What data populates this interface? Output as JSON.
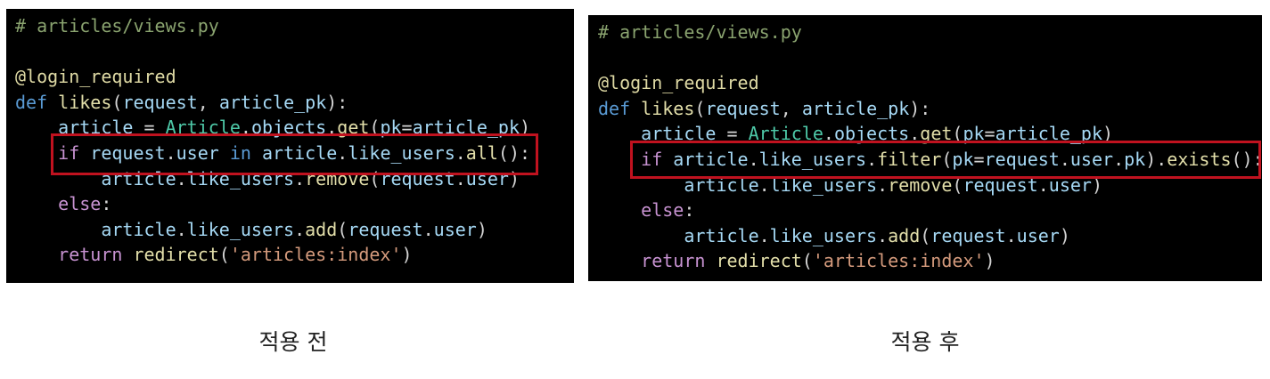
{
  "panels": [
    {
      "caption": "적용 전",
      "lines": [
        [
          {
            "t": "# articles/views.py",
            "c": "comment"
          }
        ],
        [],
        [
          {
            "t": "@login_required",
            "c": "decorator"
          }
        ],
        [
          {
            "t": "def ",
            "c": "keyword"
          },
          {
            "t": "likes",
            "c": "func"
          },
          {
            "t": "(",
            "c": "plain"
          },
          {
            "t": "request",
            "c": "param"
          },
          {
            "t": ", ",
            "c": "plain"
          },
          {
            "t": "article_pk",
            "c": "param"
          },
          {
            "t": "):",
            "c": "plain"
          }
        ],
        [
          {
            "t": "    ",
            "c": "plain"
          },
          {
            "t": "article",
            "c": "param"
          },
          {
            "t": " = ",
            "c": "plain"
          },
          {
            "t": "Article",
            "c": "class"
          },
          {
            "t": ".",
            "c": "plain"
          },
          {
            "t": "objects",
            "c": "param"
          },
          {
            "t": ".",
            "c": "plain"
          },
          {
            "t": "get",
            "c": "func"
          },
          {
            "t": "(",
            "c": "plain"
          },
          {
            "t": "pk",
            "c": "param"
          },
          {
            "t": "=",
            "c": "plain"
          },
          {
            "t": "article_pk",
            "c": "param"
          },
          {
            "t": ")",
            "c": "plain"
          }
        ],
        [
          {
            "t": "    ",
            "c": "plain"
          },
          {
            "t": "if ",
            "c": "control"
          },
          {
            "t": "request",
            "c": "param"
          },
          {
            "t": ".",
            "c": "plain"
          },
          {
            "t": "user",
            "c": "param"
          },
          {
            "t": " in ",
            "c": "keyword"
          },
          {
            "t": "article",
            "c": "param"
          },
          {
            "t": ".",
            "c": "plain"
          },
          {
            "t": "like_users",
            "c": "param"
          },
          {
            "t": ".",
            "c": "plain"
          },
          {
            "t": "all",
            "c": "func"
          },
          {
            "t": "():",
            "c": "plain"
          }
        ],
        [
          {
            "t": "        ",
            "c": "plain"
          },
          {
            "t": "article",
            "c": "param"
          },
          {
            "t": ".",
            "c": "plain"
          },
          {
            "t": "like_users",
            "c": "param"
          },
          {
            "t": ".",
            "c": "plain"
          },
          {
            "t": "remove",
            "c": "func"
          },
          {
            "t": "(",
            "c": "plain"
          },
          {
            "t": "request",
            "c": "param"
          },
          {
            "t": ".",
            "c": "plain"
          },
          {
            "t": "user",
            "c": "param"
          },
          {
            "t": ")",
            "c": "plain"
          }
        ],
        [
          {
            "t": "    ",
            "c": "plain"
          },
          {
            "t": "else",
            "c": "control"
          },
          {
            "t": ":",
            "c": "plain"
          }
        ],
        [
          {
            "t": "        ",
            "c": "plain"
          },
          {
            "t": "article",
            "c": "param"
          },
          {
            "t": ".",
            "c": "plain"
          },
          {
            "t": "like_users",
            "c": "param"
          },
          {
            "t": ".",
            "c": "plain"
          },
          {
            "t": "add",
            "c": "func"
          },
          {
            "t": "(",
            "c": "plain"
          },
          {
            "t": "request",
            "c": "param"
          },
          {
            "t": ".",
            "c": "plain"
          },
          {
            "t": "user",
            "c": "param"
          },
          {
            "t": ")",
            "c": "plain"
          }
        ],
        [
          {
            "t": "    ",
            "c": "plain"
          },
          {
            "t": "return ",
            "c": "control"
          },
          {
            "t": "redirect",
            "c": "func"
          },
          {
            "t": "(",
            "c": "plain"
          },
          {
            "t": "'articles:index'",
            "c": "string"
          },
          {
            "t": ")",
            "c": "plain"
          }
        ]
      ]
    },
    {
      "caption": "적용 후",
      "lines": [
        [
          {
            "t": "# articles/views.py",
            "c": "comment"
          }
        ],
        [],
        [
          {
            "t": "@login_required",
            "c": "decorator"
          }
        ],
        [
          {
            "t": "def ",
            "c": "keyword"
          },
          {
            "t": "likes",
            "c": "func"
          },
          {
            "t": "(",
            "c": "plain"
          },
          {
            "t": "request",
            "c": "param"
          },
          {
            "t": ", ",
            "c": "plain"
          },
          {
            "t": "article_pk",
            "c": "param"
          },
          {
            "t": "):",
            "c": "plain"
          }
        ],
        [
          {
            "t": "    ",
            "c": "plain"
          },
          {
            "t": "article",
            "c": "param"
          },
          {
            "t": " = ",
            "c": "plain"
          },
          {
            "t": "Article",
            "c": "class"
          },
          {
            "t": ".",
            "c": "plain"
          },
          {
            "t": "objects",
            "c": "param"
          },
          {
            "t": ".",
            "c": "plain"
          },
          {
            "t": "get",
            "c": "func"
          },
          {
            "t": "(",
            "c": "plain"
          },
          {
            "t": "pk",
            "c": "param"
          },
          {
            "t": "=",
            "c": "plain"
          },
          {
            "t": "article_pk",
            "c": "param"
          },
          {
            "t": ")",
            "c": "plain"
          }
        ],
        [
          {
            "t": "    ",
            "c": "plain"
          },
          {
            "t": "if ",
            "c": "control"
          },
          {
            "t": "article",
            "c": "param"
          },
          {
            "t": ".",
            "c": "plain"
          },
          {
            "t": "like_users",
            "c": "param"
          },
          {
            "t": ".",
            "c": "plain"
          },
          {
            "t": "filter",
            "c": "func"
          },
          {
            "t": "(",
            "c": "plain"
          },
          {
            "t": "pk",
            "c": "param"
          },
          {
            "t": "=",
            "c": "plain"
          },
          {
            "t": "request",
            "c": "param"
          },
          {
            "t": ".",
            "c": "plain"
          },
          {
            "t": "user",
            "c": "param"
          },
          {
            "t": ".",
            "c": "plain"
          },
          {
            "t": "pk",
            "c": "param"
          },
          {
            "t": ").",
            "c": "plain"
          },
          {
            "t": "exists",
            "c": "func"
          },
          {
            "t": "():",
            "c": "plain"
          }
        ],
        [
          {
            "t": "        ",
            "c": "plain"
          },
          {
            "t": "article",
            "c": "param"
          },
          {
            "t": ".",
            "c": "plain"
          },
          {
            "t": "like_users",
            "c": "param"
          },
          {
            "t": ".",
            "c": "plain"
          },
          {
            "t": "remove",
            "c": "func"
          },
          {
            "t": "(",
            "c": "plain"
          },
          {
            "t": "request",
            "c": "param"
          },
          {
            "t": ".",
            "c": "plain"
          },
          {
            "t": "user",
            "c": "param"
          },
          {
            "t": ")",
            "c": "plain"
          }
        ],
        [
          {
            "t": "    ",
            "c": "plain"
          },
          {
            "t": "else",
            "c": "control"
          },
          {
            "t": ":",
            "c": "plain"
          }
        ],
        [
          {
            "t": "        ",
            "c": "plain"
          },
          {
            "t": "article",
            "c": "param"
          },
          {
            "t": ".",
            "c": "plain"
          },
          {
            "t": "like_users",
            "c": "param"
          },
          {
            "t": ".",
            "c": "plain"
          },
          {
            "t": "add",
            "c": "func"
          },
          {
            "t": "(",
            "c": "plain"
          },
          {
            "t": "request",
            "c": "param"
          },
          {
            "t": ".",
            "c": "plain"
          },
          {
            "t": "user",
            "c": "param"
          },
          {
            "t": ")",
            "c": "plain"
          }
        ],
        [
          {
            "t": "    ",
            "c": "plain"
          },
          {
            "t": "return ",
            "c": "control"
          },
          {
            "t": "redirect",
            "c": "func"
          },
          {
            "t": "(",
            "c": "plain"
          },
          {
            "t": "'articles:index'",
            "c": "string"
          },
          {
            "t": ")",
            "c": "plain"
          }
        ]
      ]
    }
  ],
  "colors": {
    "panel_background": "#000000",
    "highlight_border": "#c0121f",
    "comment": "#8aa36f",
    "keyword": "#5a9bd5",
    "control": "#c792d1",
    "function": "#e3dfaa",
    "identifier": "#a6d9f5",
    "class": "#4ec9a8",
    "string": "#d49a7c"
  },
  "highlighted_line_index": 5
}
